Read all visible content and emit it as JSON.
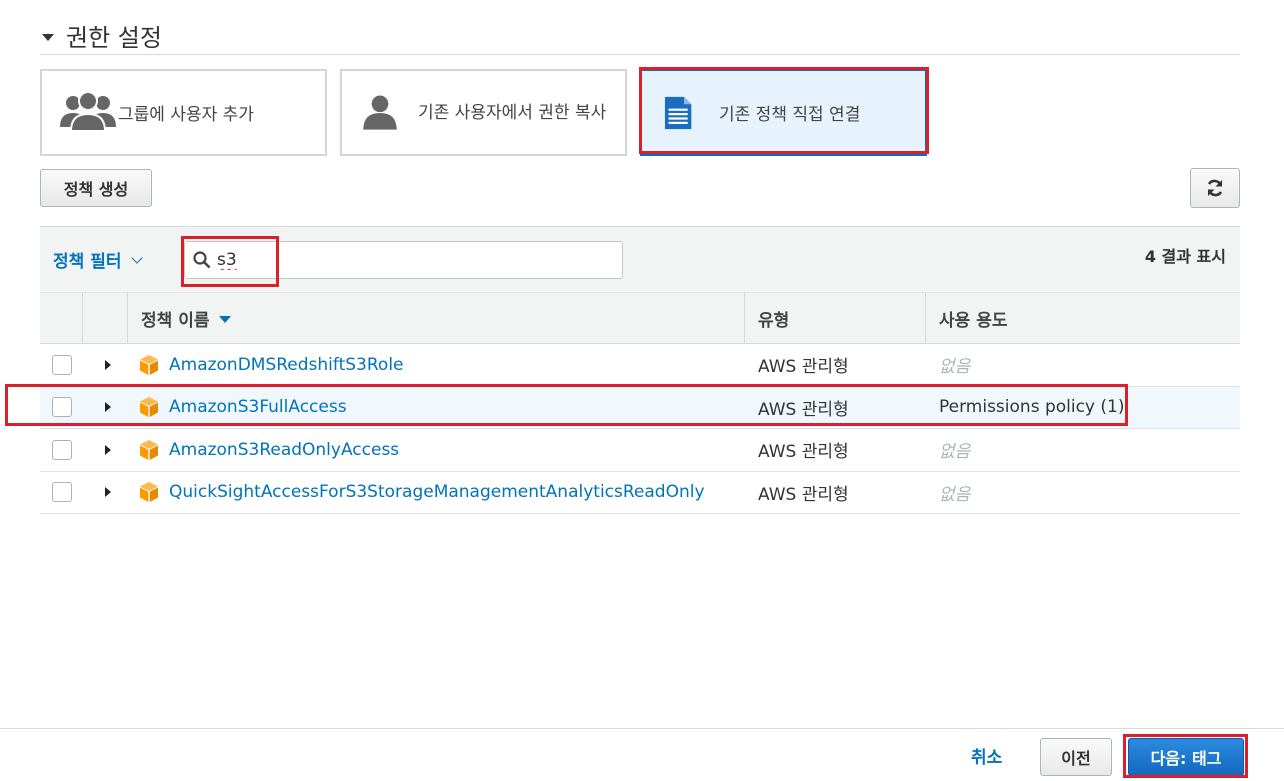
{
  "section": {
    "title": "권한 설정"
  },
  "options": [
    {
      "label": "그룹에 사용자 추가",
      "icon": "users-group-icon"
    },
    {
      "label": "기존 사용자에서 권한 복사",
      "icon": "user-icon"
    },
    {
      "label": "기존 정책 직접 연결",
      "icon": "document-icon",
      "selected": true
    }
  ],
  "toolbar": {
    "create_policy_label": "정책 생성",
    "refresh_icon": "refresh-icon"
  },
  "filter": {
    "label": "정책 필터",
    "search_value": "s3",
    "result_count": "4 결과 표시"
  },
  "table": {
    "columns": [
      "정책 이름",
      "유형",
      "사용 용도"
    ],
    "rows": [
      {
        "name": "AmazonDMSRedshiftS3Role",
        "type": "AWS 관리형",
        "usage": "없음"
      },
      {
        "name": "AmazonS3FullAccess",
        "type": "AWS 관리형",
        "usage": "Permissions policy (1)"
      },
      {
        "name": "AmazonS3ReadOnlyAccess",
        "type": "AWS 관리형",
        "usage": "없음"
      },
      {
        "name": "QuickSightAccessForS3StorageManagementAnalyticsReadOnly",
        "type": "AWS 관리형",
        "usage": "없음"
      }
    ]
  },
  "footer": {
    "cancel_label": "취소",
    "previous_label": "이전",
    "next_label": "다음: 태그"
  },
  "colors": {
    "accent": "#0073bb",
    "highlight": "#d9202c",
    "policy_icon": "#f90"
  }
}
